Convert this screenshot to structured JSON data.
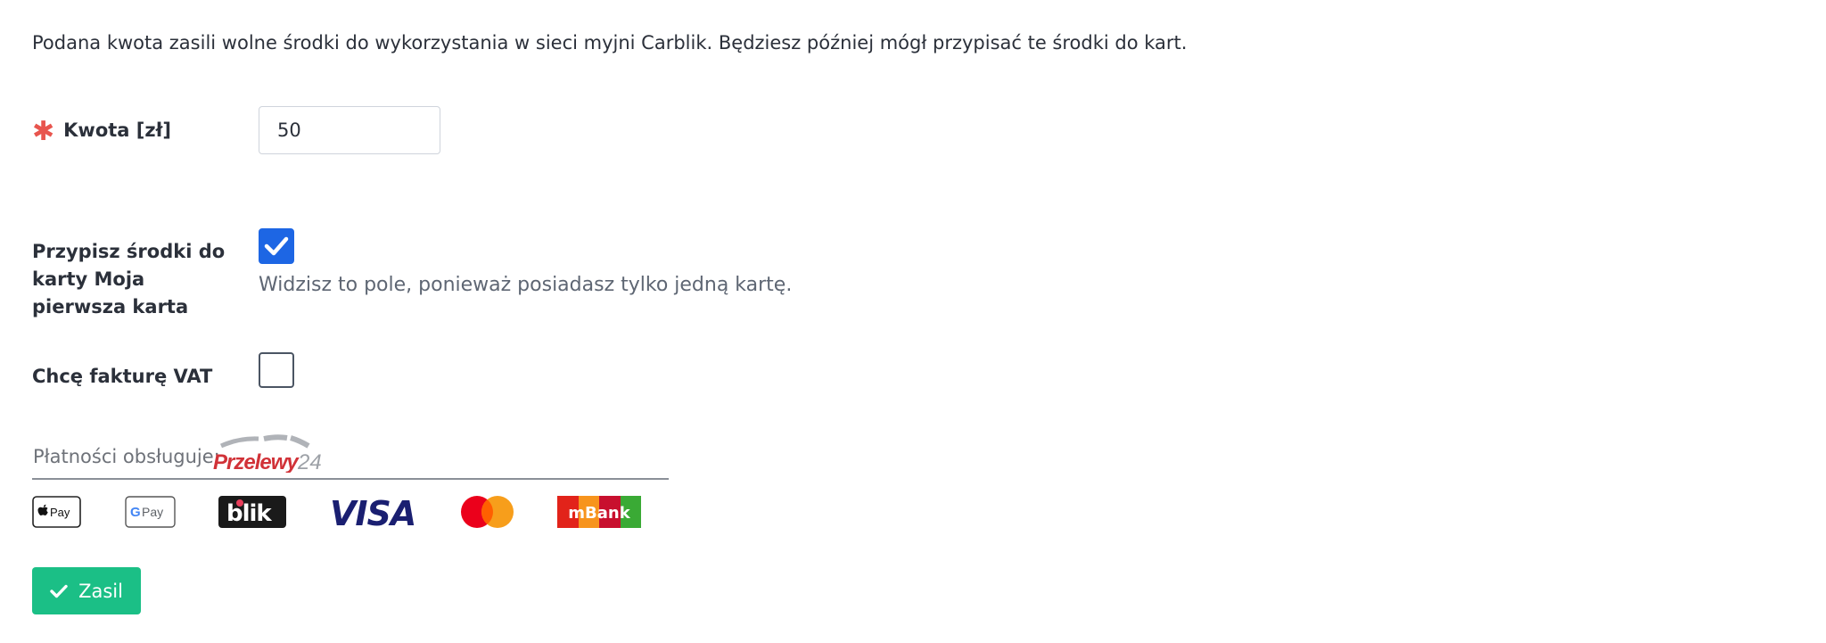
{
  "intro_text": "Podana kwota zasili wolne środki do wykorzystania w sieci myjni Carblik. Będziesz później mógł przypisać te środki do kart.",
  "amount": {
    "label": "Kwota [zł]",
    "required_mark": "✱",
    "value": "50"
  },
  "assign": {
    "label_lines": [
      "Przypisz środki do",
      "karty Moja",
      "pierwsza karta"
    ],
    "checked": true,
    "help_text": "Widzisz to pole, ponieważ posiadasz tylko jedną kartę."
  },
  "invoice": {
    "label": "Chcę fakturę VAT",
    "checked": false
  },
  "payments": {
    "label": "Płatności obsługuje:",
    "provider_logo_text": "Przelewy24",
    "methods": [
      {
        "name": "Apple Pay",
        "icon": "apple-pay-icon",
        "text": "Pay"
      },
      {
        "name": "Google Pay",
        "icon": "google-pay-icon",
        "text": "Pay"
      },
      {
        "name": "BLIK",
        "icon": "blik-icon",
        "text": "blik"
      },
      {
        "name": "VISA",
        "icon": "visa-icon",
        "text": "VISA"
      },
      {
        "name": "Mastercard",
        "icon": "mastercard-icon"
      },
      {
        "name": "mBank",
        "icon": "mbank-icon",
        "text": "mBank"
      }
    ]
  },
  "submit": {
    "label": "Zasil",
    "icon": "checkmark-icon"
  },
  "colors": {
    "accent_green": "#1bbf86",
    "checkbox_blue": "#1d66e4",
    "required_red": "#e8554e"
  }
}
